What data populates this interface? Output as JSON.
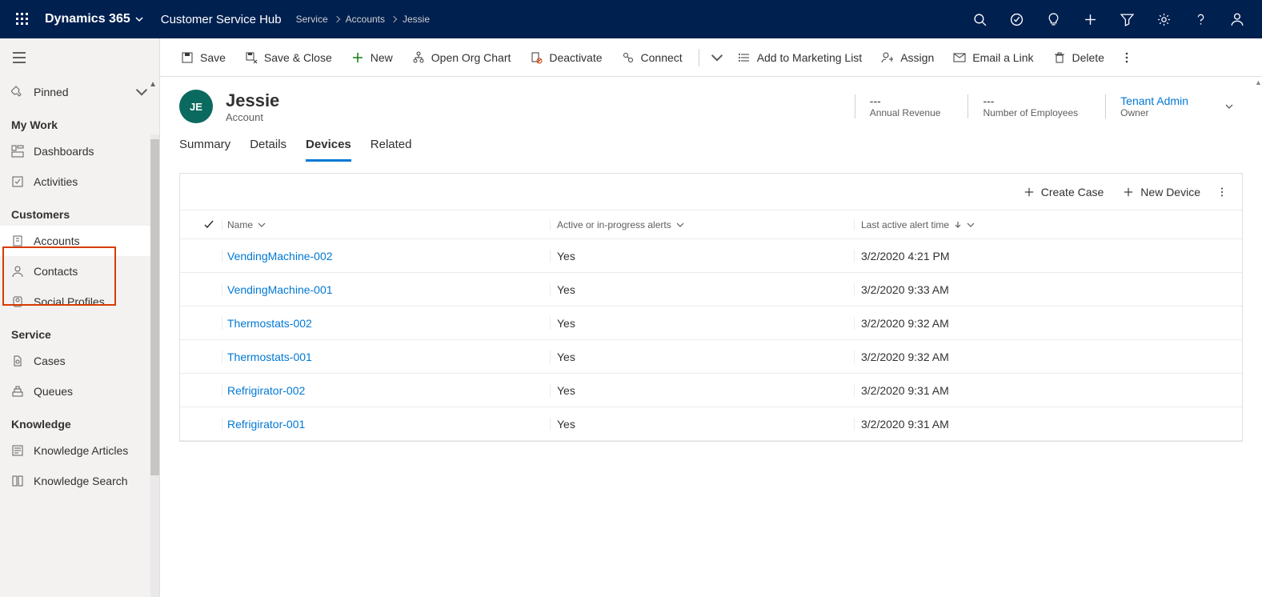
{
  "navbar": {
    "brand": "Dynamics 365",
    "hub": "Customer Service Hub",
    "breadcrumbs": [
      "Service",
      "Accounts",
      "Jessie"
    ]
  },
  "sidebar": {
    "pinned": "Pinned",
    "sections": {
      "mywork": {
        "label": "My Work",
        "items": [
          "Dashboards",
          "Activities"
        ]
      },
      "customers": {
        "label": "Customers",
        "items": [
          "Accounts",
          "Contacts",
          "Social Profiles"
        ]
      },
      "service": {
        "label": "Service",
        "items": [
          "Cases",
          "Queues"
        ]
      },
      "knowledge": {
        "label": "Knowledge",
        "items": [
          "Knowledge Articles",
          "Knowledge Search"
        ]
      }
    }
  },
  "commandbar": {
    "save": "Save",
    "saveclose": "Save & Close",
    "new": "New",
    "orgchart": "Open Org Chart",
    "deactivate": "Deactivate",
    "connect": "Connect",
    "addmarketing": "Add to Marketing List",
    "assign": "Assign",
    "emaillink": "Email a Link",
    "delete": "Delete"
  },
  "record": {
    "initials": "JE",
    "title": "Jessie",
    "subtitle": "Account",
    "kpis": {
      "revenue": {
        "value": "---",
        "label": "Annual Revenue"
      },
      "employees": {
        "value": "---",
        "label": "Number of Employees"
      },
      "owner": {
        "value": "Tenant Admin",
        "label": "Owner"
      }
    }
  },
  "tabs": [
    "Summary",
    "Details",
    "Devices",
    "Related"
  ],
  "grid": {
    "toolbar": {
      "createcase": "Create Case",
      "newdevice": "New Device"
    },
    "columns": {
      "name": "Name",
      "alerts": "Active or in-progress alerts",
      "time": "Last active alert time"
    },
    "rows": [
      {
        "name": "VendingMachine-002",
        "alerts": "Yes",
        "time": "3/2/2020 4:21 PM"
      },
      {
        "name": "VendingMachine-001",
        "alerts": "Yes",
        "time": "3/2/2020 9:33 AM"
      },
      {
        "name": "Thermostats-002",
        "alerts": "Yes",
        "time": "3/2/2020 9:32 AM"
      },
      {
        "name": "Thermostats-001",
        "alerts": "Yes",
        "time": "3/2/2020 9:32 AM"
      },
      {
        "name": "Refrigirator-002",
        "alerts": "Yes",
        "time": "3/2/2020 9:31 AM"
      },
      {
        "name": "Refrigirator-001",
        "alerts": "Yes",
        "time": "3/2/2020 9:31 AM"
      }
    ]
  }
}
